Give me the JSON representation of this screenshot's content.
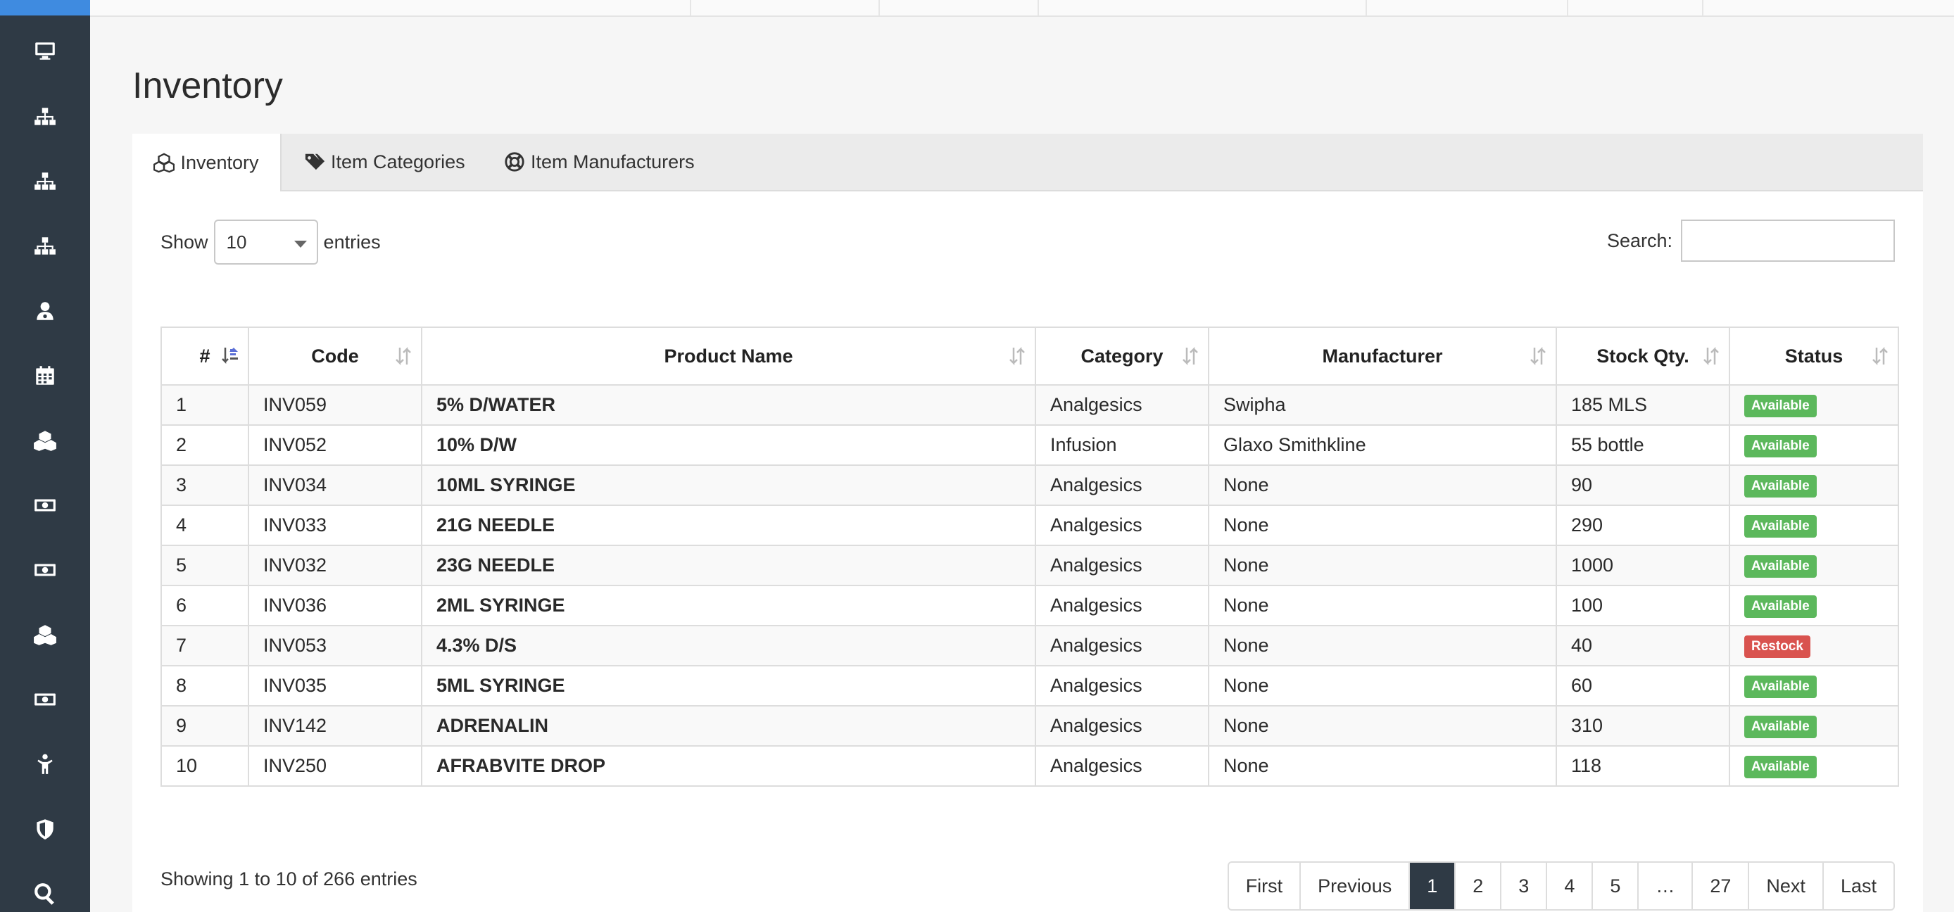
{
  "page": {
    "title": "Inventory"
  },
  "tabs": [
    {
      "label": "Inventory",
      "icon": "cubes-icon"
    },
    {
      "label": "Item Categories",
      "icon": "tags-icon"
    },
    {
      "label": "Item Manufacturers",
      "icon": "life-ring-icon"
    }
  ],
  "length_menu": {
    "prefix": "Show",
    "value": "10",
    "suffix": "entries"
  },
  "search": {
    "label": "Search:",
    "value": ""
  },
  "table": {
    "columns": [
      "#",
      "Code",
      "Product Name",
      "Category",
      "Manufacturer",
      "Stock Qty.",
      "Status"
    ],
    "rows": [
      {
        "n": "1",
        "code": "INV059",
        "product": "5% D/WATER",
        "category": "Analgesics",
        "manufacturer": "Swipha",
        "stock": "185 MLS",
        "status": "Available"
      },
      {
        "n": "2",
        "code": "INV052",
        "product": "10% D/W",
        "category": "Infusion",
        "manufacturer": "Glaxo Smithkline",
        "stock": "55 bottle",
        "status": "Available"
      },
      {
        "n": "3",
        "code": "INV034",
        "product": "10ML SYRINGE",
        "category": "Analgesics",
        "manufacturer": "None",
        "stock": "90",
        "status": "Available"
      },
      {
        "n": "4",
        "code": "INV033",
        "product": "21G NEEDLE",
        "category": "Analgesics",
        "manufacturer": "None",
        "stock": "290",
        "status": "Available"
      },
      {
        "n": "5",
        "code": "INV032",
        "product": "23G NEEDLE",
        "category": "Analgesics",
        "manufacturer": "None",
        "stock": "1000",
        "status": "Available"
      },
      {
        "n": "6",
        "code": "INV036",
        "product": "2ML SYRINGE",
        "category": "Analgesics",
        "manufacturer": "None",
        "stock": "100",
        "status": "Available"
      },
      {
        "n": "7",
        "code": "INV053",
        "product": "4.3% D/S",
        "category": "Analgesics",
        "manufacturer": "None",
        "stock": "40",
        "status": "Restock"
      },
      {
        "n": "8",
        "code": "INV035",
        "product": "5ML SYRINGE",
        "category": "Analgesics",
        "manufacturer": "None",
        "stock": "60",
        "status": "Available"
      },
      {
        "n": "9",
        "code": "INV142",
        "product": "ADRENALIN",
        "category": "Analgesics",
        "manufacturer": "None",
        "stock": "310",
        "status": "Available"
      },
      {
        "n": "10",
        "code": "INV250",
        "product": "AFRABVITE DROP",
        "category": "Analgesics",
        "manufacturer": "None",
        "stock": "118",
        "status": "Available"
      }
    ]
  },
  "status_colors": {
    "Available": "#5cb85c",
    "Restock": "#d9534f"
  },
  "footer": {
    "info": "Showing 1 to 10 of 266 entries",
    "pagination": [
      "First",
      "Previous",
      "1",
      "2",
      "3",
      "4",
      "5",
      "…",
      "27",
      "Next",
      "Last"
    ],
    "active_page": "1"
  },
  "sidebar_icons": [
    "desktop-icon",
    "sitemap-icon",
    "sitemap-icon",
    "sitemap-icon",
    "user-md-icon",
    "calendar-icon",
    "cubes-icon",
    "money-icon",
    "money-icon",
    "cubes-icon",
    "money-icon",
    "child-icon",
    "shield-icon",
    "search-icon"
  ]
}
